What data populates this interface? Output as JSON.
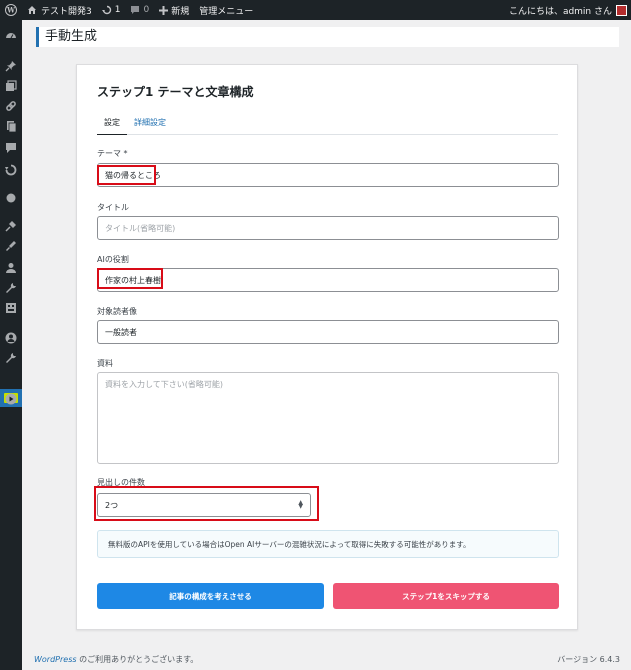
{
  "adminbar": {
    "site_name": "テスト開発3",
    "updates_count": "1",
    "comments_count": "0",
    "new_label": "新規",
    "manage_menu": "管理メニュー",
    "greeting": "こんにちは、admin さん"
  },
  "page": {
    "title": "手動生成"
  },
  "card": {
    "title": "ステップ1 テーマと文章構成",
    "tabs": [
      {
        "label": "設定",
        "active": true
      },
      {
        "label": "詳細設定",
        "active": false
      }
    ],
    "fields": {
      "theme": {
        "label": "テーマ *",
        "value": "猫の帰るところ"
      },
      "title": {
        "label": "タイトル",
        "placeholder": "タイトル(省略可能)"
      },
      "ai_role": {
        "label": "AIの役割",
        "value": "作家の村上春樹"
      },
      "audience": {
        "label": "対象読者像",
        "value": "一般読者"
      },
      "material": {
        "label": "資料",
        "placeholder": "資料を入力して下さい(省略可能)"
      },
      "heading_count": {
        "label": "見出しの件数",
        "value": "2つ"
      }
    },
    "notice": "無料版のAPIを使用している場合はOpen AIサーバーの混雑状況によって取得に失敗する可能性があります。",
    "buttons": {
      "primary": "記事の構成を考えさせる",
      "skip": "ステップ1をスキップする"
    }
  },
  "footer": {
    "wordpress": "WordPress",
    "thanks": " のご利用ありがとうございます。",
    "version": "バージョン 6.4.3"
  },
  "colors": {
    "admin_bg": "#1d2327",
    "accent": "#2271b1",
    "primary_button": "#1e88e5",
    "skip_button": "#ef5473",
    "highlight": "#d80c18"
  }
}
